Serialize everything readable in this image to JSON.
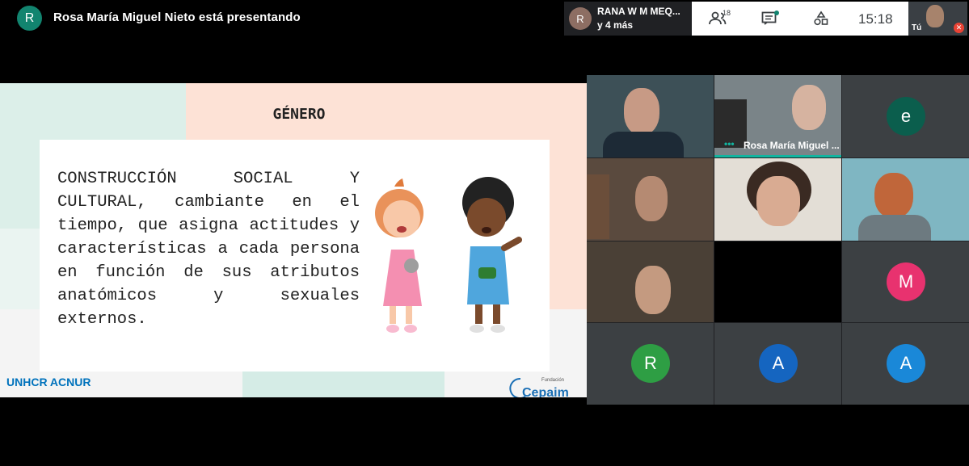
{
  "header": {
    "presenter_initial": "R",
    "presenter_text": "Rosa María Miguel Nieto está presentando"
  },
  "raised": {
    "initial": "R",
    "name": "RANA W M MEQ...",
    "more": "y 4 más"
  },
  "toolbar": {
    "participants_count": "18",
    "time": "15:18",
    "self_label": "Tú",
    "icons": [
      "people-icon",
      "chat-icon",
      "activities-icon"
    ]
  },
  "slide": {
    "title": "GÉNERO",
    "text": "CONSTRUCCIÓN SOCIAL Y CULTURAL, cambiante en el tiempo, que asigna actitudes y características a cada persona en función de sus atributos anatómicos y sexuales externos.",
    "logo_left": "UNHCR ACNUR",
    "logo_right": "Cepaim",
    "logo_right_small": "Fundación"
  },
  "participants": {
    "presenter_tile_name": "Rosa María Miguel ...",
    "avatar_e": "e",
    "avatar_m": "M",
    "avatar_r": "R",
    "avatar_a1": "A",
    "avatar_a2": "A"
  },
  "colors": {
    "teal": "#12846f",
    "highlight": "#12b5a0",
    "e_avatar": "#0b5e4d",
    "m_avatar": "#e8326f",
    "r_avatar": "#2e9e44",
    "a1_avatar": "#1565c0",
    "a2_avatar": "#1a88d8"
  }
}
